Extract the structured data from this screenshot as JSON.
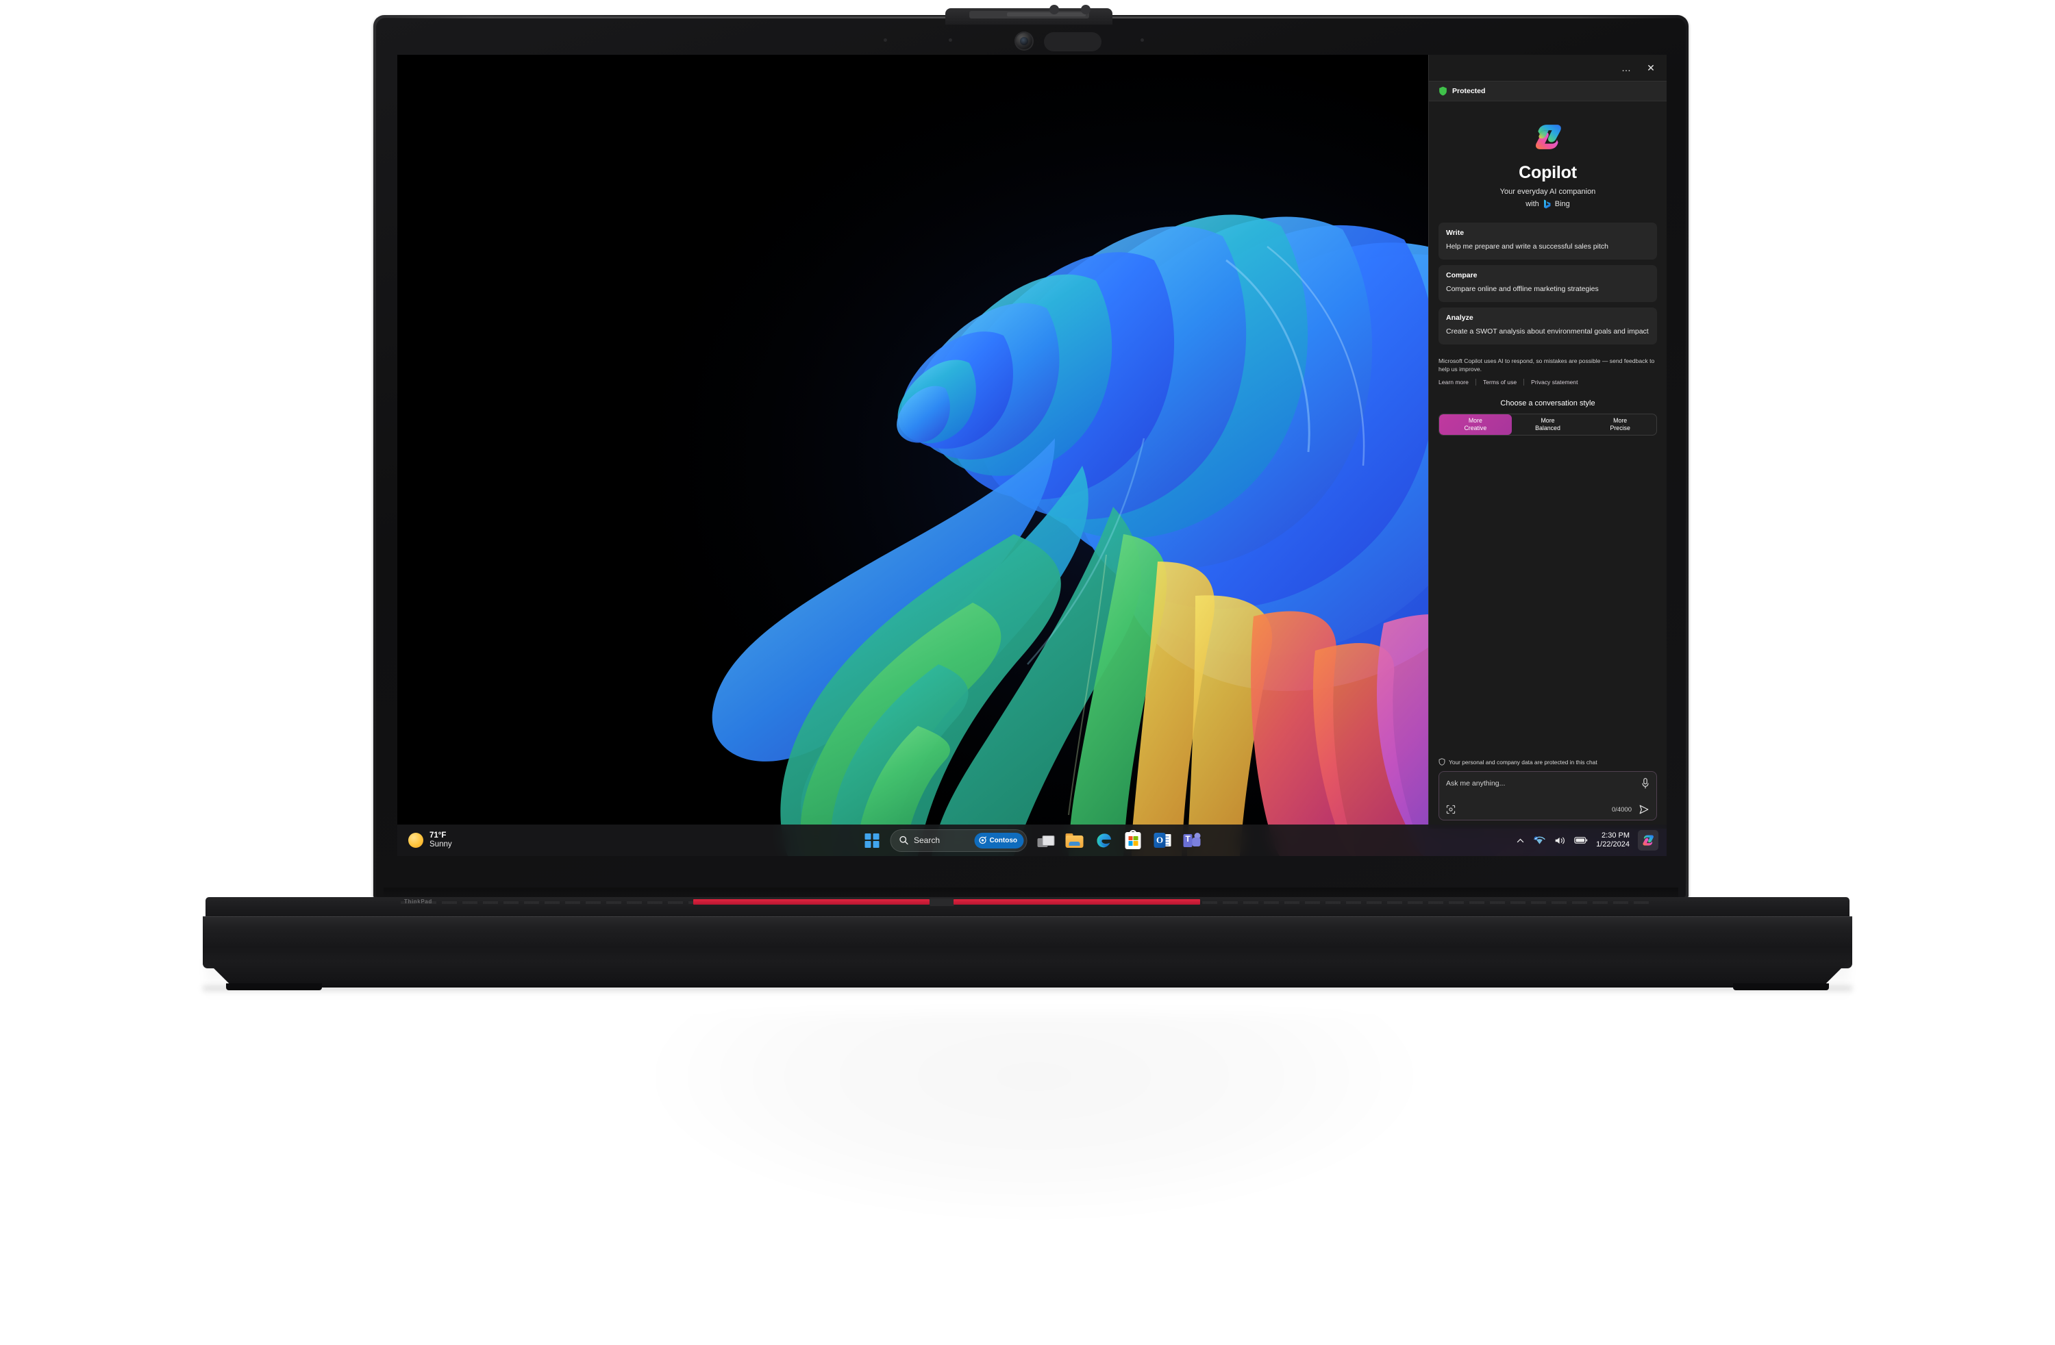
{
  "device": {
    "brand": "ThinkPad",
    "accent_color": "#e0243f",
    "webcam_label": "webcam-notch"
  },
  "desktop": {
    "wallpaper_name": "windows-bloom-abstract-wallpaper",
    "background_color": "#000000"
  },
  "taskbar": {
    "weather": {
      "temperature": "71°F",
      "condition": "Sunny",
      "icon": "sun-icon"
    },
    "start_button": "start-button",
    "search": {
      "placeholder": "Search",
      "icon": "search-icon",
      "badge_label": "Contoso",
      "badge_color": "#0f6cbd"
    },
    "apps": [
      {
        "name": "Task View",
        "icon": "task-view-icon"
      },
      {
        "name": "File Explorer",
        "icon": "file-explorer-icon"
      },
      {
        "name": "Microsoft Edge",
        "icon": "edge-icon"
      },
      {
        "name": "Microsoft Store",
        "icon": "microsoft-store-icon"
      },
      {
        "name": "Outlook",
        "icon": "outlook-icon"
      },
      {
        "name": "Microsoft Teams",
        "icon": "teams-icon"
      }
    ],
    "tray": {
      "chevron": "chevron-up-icon",
      "network": "wifi-icon",
      "volume": "volume-icon",
      "battery": "battery-icon",
      "time": "2:30 PM",
      "date": "1/22/2024",
      "copilot": "copilot-icon"
    }
  },
  "copilot": {
    "titlebar": {
      "more_label": "…",
      "close_label": "✕"
    },
    "protected_badge": {
      "label": "Protected",
      "icon": "shield-icon",
      "color": "#3fc14a"
    },
    "hero": {
      "logo": "copilot-logo",
      "title": "Copilot",
      "subtitle": "Your everyday AI companion",
      "with_label": "with",
      "bing_label": "Bing",
      "bing_icon": "bing-icon"
    },
    "cards": [
      {
        "heading": "Write",
        "description": "Help me prepare and write a successful sales pitch"
      },
      {
        "heading": "Compare",
        "description": "Compare online and offline marketing strategies"
      },
      {
        "heading": "Analyze",
        "description": "Create a SWOT analysis about environmental goals and impact"
      }
    ],
    "disclaimer": "Microsoft Copilot uses AI to respond, so mistakes are possible — send feedback to help us improve.",
    "links": [
      "Learn more",
      "Terms of use",
      "Privacy statement"
    ],
    "style_section": {
      "label": "Choose a conversation style",
      "options": [
        {
          "line1": "More",
          "line2": "Creative",
          "active": true
        },
        {
          "line1": "More",
          "line2": "Balanced",
          "active": false
        },
        {
          "line1": "More",
          "line2": "Precise",
          "active": false
        }
      ],
      "active_color": "#c0399f"
    },
    "composer": {
      "protection_note": "Your personal and company data are protected in this chat",
      "protection_icon": "shield-outline-icon",
      "placeholder": "Ask me anything...",
      "mic_icon": "microphone-icon",
      "scan_icon": "scan-icon",
      "char_count": "0/4000",
      "send_icon": "send-icon"
    }
  }
}
